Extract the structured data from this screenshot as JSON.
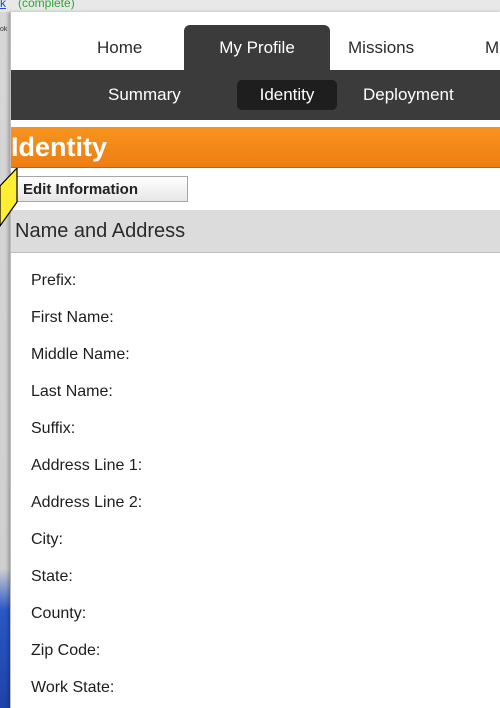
{
  "background": {
    "link_text": "k",
    "status_text": "(complete)",
    "sidebar_text": "ok"
  },
  "top_nav": {
    "tabs": [
      {
        "label": "Home",
        "active": false
      },
      {
        "label": "My Profile",
        "active": true
      },
      {
        "label": "Missions",
        "active": false
      },
      {
        "label": "M",
        "active": false
      }
    ]
  },
  "sub_nav": {
    "tabs": [
      {
        "label": "Summary",
        "active": false
      },
      {
        "label": "Identity",
        "active": true
      },
      {
        "label": "Deployment",
        "active": false
      }
    ]
  },
  "page_title": "Identity",
  "edit_button_label": "Edit Information",
  "section": {
    "title": "Name and Address",
    "fields": [
      "Prefix:",
      "First Name:",
      "Middle Name:",
      "Last Name:",
      "Suffix:",
      "Address Line 1:",
      "Address Line 2:",
      "City:",
      "State:",
      "County:",
      "Zip Code:",
      "Work State:"
    ]
  },
  "colors": {
    "title_bar": "#f7941e",
    "nav_dark": "#3b3b3b",
    "section_header": "#dcdcdc",
    "callout": "#ffee33"
  }
}
